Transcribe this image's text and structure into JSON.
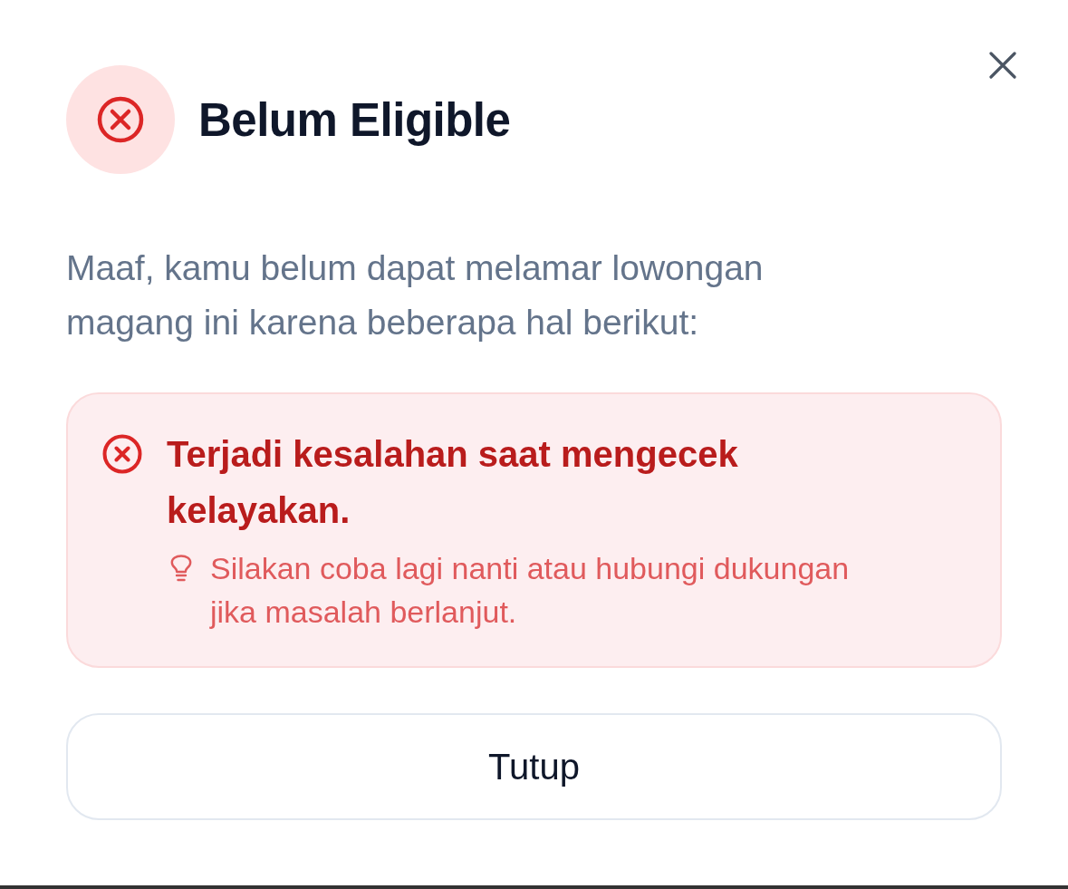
{
  "dialog": {
    "title": "Belum Eligible",
    "message": "Maaf, kamu belum dapat melamar lowongan magang ini karena beberapa hal berikut:"
  },
  "alert": {
    "items": [
      {
        "title": "Terjadi kesalahan saat mengecek kelayakan.",
        "hint": "Silakan coba lagi nanti atau hubungi dukungan jika masalah berlanjut."
      }
    ]
  },
  "buttons": [
    {
      "label": "Tutup"
    }
  ]
}
